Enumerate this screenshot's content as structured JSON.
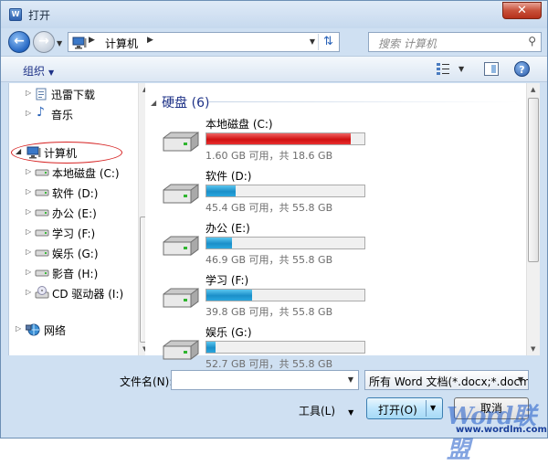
{
  "window": {
    "title": "打开",
    "close_label": "✕"
  },
  "address": {
    "path": "计算机",
    "search_placeholder": "搜索 计算机"
  },
  "toolbar": {
    "organize_label": "组织"
  },
  "nav": {
    "items": [
      {
        "label": "迅雷下载"
      },
      {
        "label": "音乐"
      },
      {
        "label": "计算机"
      },
      {
        "label": "本地磁盘 (C:)"
      },
      {
        "label": "软件 (D:)"
      },
      {
        "label": "办公 (E:)"
      },
      {
        "label": "学习 (F:)"
      },
      {
        "label": "娱乐 (G:)"
      },
      {
        "label": "影音 (H:)"
      },
      {
        "label": "CD 驱动器 (I:)"
      },
      {
        "label": "网络"
      }
    ]
  },
  "content": {
    "group_title": "硬盘 (6)",
    "drives": [
      {
        "name": "本地磁盘 (C:)",
        "info": "1.60 GB 可用，共 18.6 GB",
        "used_fraction": 0.914,
        "color": "red"
      },
      {
        "name": "软件 (D:)",
        "info": "45.4 GB 可用，共 55.8 GB",
        "used_fraction": 0.186,
        "color": "blue"
      },
      {
        "name": "办公 (E:)",
        "info": "46.9 GB 可用，共 55.8 GB",
        "used_fraction": 0.16,
        "color": "blue"
      },
      {
        "name": "学习 (F:)",
        "info": "39.8 GB 可用，共 55.8 GB",
        "used_fraction": 0.287,
        "color": "blue"
      },
      {
        "name": "娱乐 (G:)",
        "info": "52.7 GB 可用，共 55.8 GB",
        "used_fraction": 0.056,
        "color": "blue"
      }
    ]
  },
  "bottom": {
    "filename_label": "文件名(N):",
    "filename_value": "",
    "filter_value": "所有 Word 文档(*.docx;*.docm",
    "tools_label": "工具(L)",
    "open_label": "打开(O)",
    "cancel_label": "取消"
  },
  "watermark": {
    "logo_text": "Word联盟",
    "url": "www.wordlm.com"
  },
  "colors": {
    "accent": "#1e3287",
    "bar_blue": "#1b8fc9",
    "bar_red": "#d01010"
  }
}
